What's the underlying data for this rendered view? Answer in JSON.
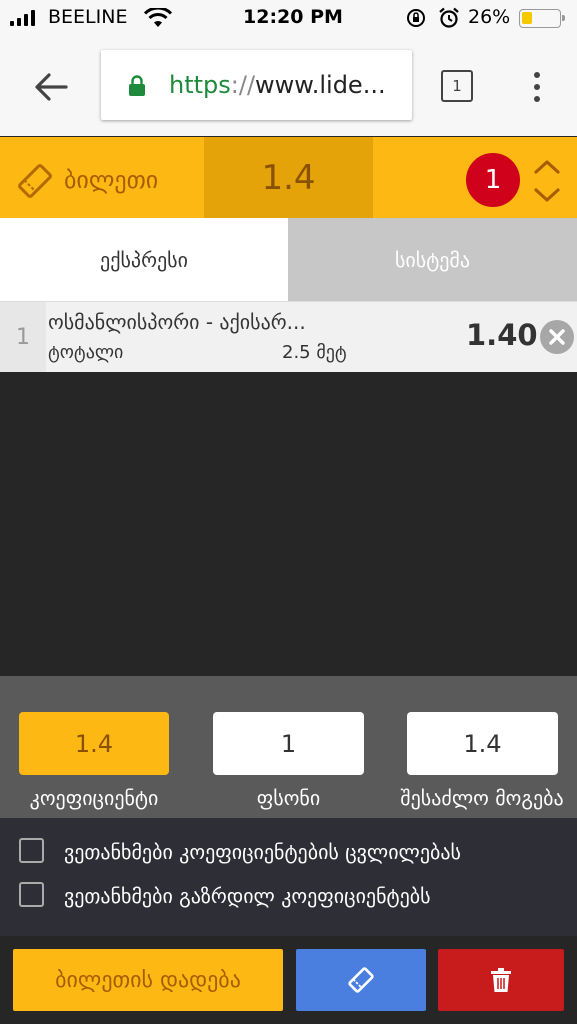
{
  "status_bar": {
    "carrier": "BEELINE",
    "time": "12:20 PM",
    "battery": "26%"
  },
  "browser": {
    "url_scheme": "https",
    "url_sep": "://",
    "url_rest": "www.lide...",
    "tab_count": "1"
  },
  "ticket": {
    "label": "ბილეთი",
    "odds": "1.4",
    "count": "1"
  },
  "tabs": [
    {
      "label": "ექსპრესი",
      "active": true
    },
    {
      "label": "სისტემა",
      "active": false
    }
  ],
  "bets": [
    {
      "index": "1",
      "match": "ოსმანლისპორი - აქისარ...",
      "market": "ტოტალი",
      "selection": "2.5 მეტ",
      "odds": "1.40"
    }
  ],
  "summary": {
    "coefficient": {
      "value": "1.4",
      "label": "კოეფიციენტი"
    },
    "stake": {
      "value": "1",
      "label": "ფსონი"
    },
    "payout": {
      "value": "1.4",
      "label": "შესაძლო მოგება"
    }
  },
  "agreements": [
    {
      "label": "ვეთანხმები კოეფიციენტების ცვლილებას",
      "checked": false
    },
    {
      "label": "ვეთანხმები გაზრდილ კოეფიციენტებს",
      "checked": false
    }
  ],
  "actions": {
    "place_bet": "ბილეთის დადება"
  },
  "colors": {
    "accent": "#fdb813",
    "accent_dark": "#e5a30a",
    "badge": "#d0021b",
    "blue": "#4a7fe0",
    "red": "#c81c1c",
    "url_green": "#1f8a3b"
  }
}
